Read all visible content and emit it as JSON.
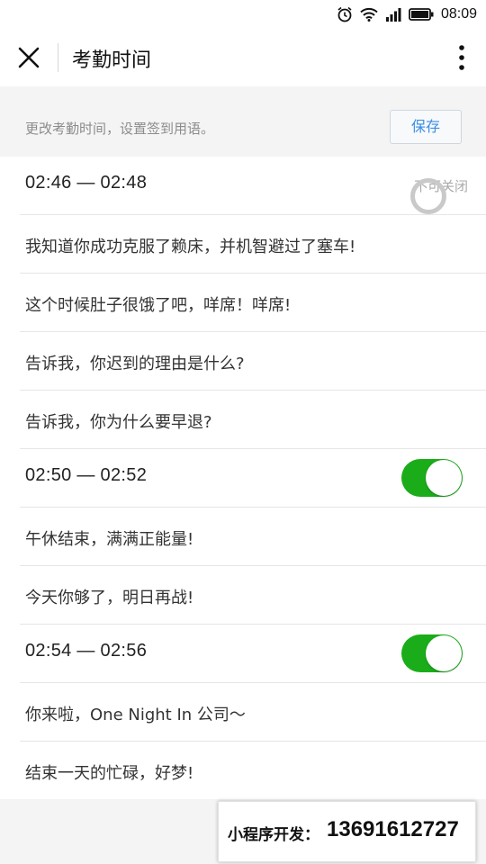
{
  "status_bar": {
    "time": "08:09",
    "icons": [
      "alarm-icon",
      "wifi-icon",
      "signal-icon",
      "battery-icon"
    ]
  },
  "nav": {
    "title": "考勤时间",
    "close_icon": "close-icon",
    "more_icon": "more-vertical-icon"
  },
  "intro": {
    "text": "更改考勤时间，设置签到用语。",
    "save_label": "保存"
  },
  "schedules": [
    {
      "time": "02:46 — 02:48",
      "status_text": "不可关闭",
      "toggle_on": null,
      "messages": [
        "我知道你成功克服了赖床，并机智避过了塞车!",
        "这个时候肚子很饿了吧，咩席！咩席!",
        "告诉我，你迟到的理由是什么?",
        "告诉我，你为什么要早退?"
      ]
    },
    {
      "time": "02:50 — 02:52",
      "toggle_on": true,
      "messages": [
        "午休结束，满满正能量!",
        "今天你够了，明日再战!"
      ]
    },
    {
      "time": "02:54 — 02:56",
      "toggle_on": true,
      "messages": [
        "你来啦，One Night In 公司〜",
        "结束一天的忙碌，好梦!"
      ]
    }
  ],
  "watermark": {
    "label": "小程序开发：",
    "phone": "13691612727"
  },
  "colors": {
    "accent_green": "#1aad19",
    "link_blue": "#3a8ee6"
  }
}
